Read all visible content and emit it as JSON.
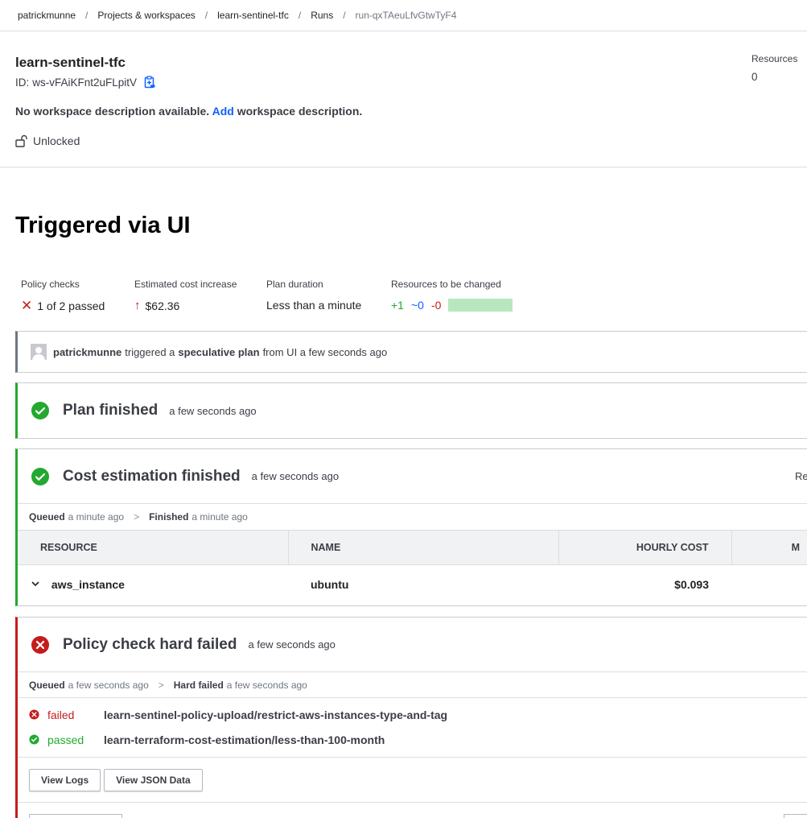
{
  "breadcrumb": {
    "items": [
      "patrickmunne",
      "Projects & workspaces",
      "learn-sentinel-tfc",
      "Runs",
      "run-qxTAeuLfvGtwTyF4"
    ],
    "separator": "/"
  },
  "workspace": {
    "name": "learn-sentinel-tfc",
    "id_label": "ID:",
    "id_value": "ws-vFAiKFnt2uFLpitV",
    "resources_label": "Resources",
    "resources_value": "0",
    "desc_before": "No workspace description available.",
    "desc_link": "Add",
    "desc_after": "workspace description.",
    "lock_status": "Unlocked"
  },
  "run": {
    "title": "Triggered via UI",
    "summary": {
      "policy_label": "Policy checks",
      "policy_value": "1 of 2 passed",
      "cost_label": "Estimated cost increase",
      "cost_value": "$62.36",
      "duration_label": "Plan duration",
      "duration_value": "Less than a minute",
      "resources_label": "Resources to be changed",
      "add": "+1",
      "change": "~0",
      "destroy": "-0"
    }
  },
  "trigger": {
    "user": "patrickmunne",
    "text1": "triggered a",
    "plan_type": "speculative plan",
    "text2": "from UI a few seconds ago"
  },
  "plan": {
    "title": "Plan finished",
    "time": "a few seconds ago"
  },
  "cost_estimation": {
    "title": "Cost estimation finished",
    "time": "a few seconds ago",
    "right_clip": "Re",
    "queued_label": "Queued",
    "queued_time": "a minute ago",
    "finished_label": "Finished",
    "finished_time": "a minute ago",
    "columns": [
      "RESOURCE",
      "NAME",
      "HOURLY COST",
      "M"
    ],
    "rows": [
      {
        "resource": "aws_instance",
        "name": "ubuntu",
        "hourly": "$0.093"
      }
    ]
  },
  "policy_check": {
    "title": "Policy check hard failed",
    "time": "a few seconds ago",
    "queued_label": "Queued",
    "queued_time": "a few seconds ago",
    "hard_failed_label": "Hard failed",
    "hard_failed_time": "a few seconds ago",
    "results": [
      {
        "status": "failed",
        "name": "learn-sentinel-policy-upload/restrict-aws-instances-type-and-tag"
      },
      {
        "status": "passed",
        "name": "learn-terraform-cost-estimation/less-than-100-month"
      }
    ],
    "view_logs": "View Logs",
    "view_json": "View JSON Data"
  },
  "colors": {
    "success": "#23a830",
    "danger": "#c41c1c",
    "link": "#1060ff",
    "resource_bar": "#b8e7be"
  }
}
